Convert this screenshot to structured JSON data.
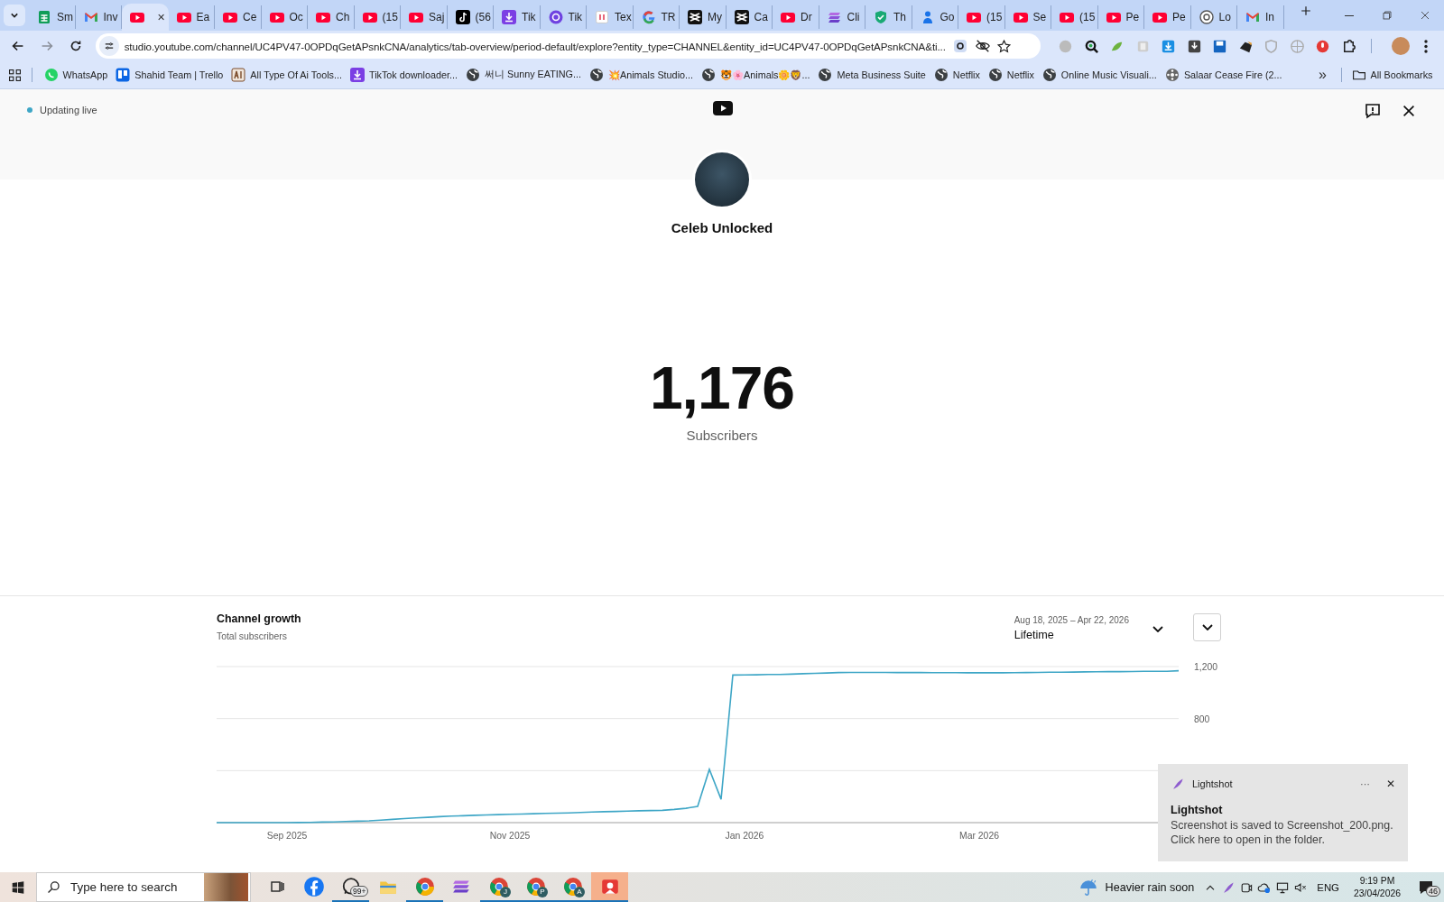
{
  "browser": {
    "tabs": [
      {
        "kind": "sheets",
        "title": "Sm",
        "selected": false
      },
      {
        "kind": "gmail",
        "title": "Inv",
        "selected": false
      },
      {
        "kind": "youtube",
        "selected": true,
        "close": "✕"
      },
      {
        "kind": "youtube",
        "title": "Ea",
        "selected": false
      },
      {
        "kind": "youtube",
        "title": "Ce",
        "selected": false
      },
      {
        "kind": "youtube",
        "title": "Oc",
        "selected": false
      },
      {
        "kind": "youtube",
        "title": "Ch",
        "selected": false
      },
      {
        "kind": "youtube",
        "title": "(15",
        "selected": false
      },
      {
        "kind": "youtube",
        "title": "Saj",
        "selected": false
      },
      {
        "kind": "tiktok",
        "title": "(56",
        "selected": false
      },
      {
        "kind": "downloader",
        "title": "Tik",
        "selected": false
      },
      {
        "kind": "tokcircle",
        "title": "Tik",
        "selected": false
      },
      {
        "kind": "doc",
        "title": "Tex",
        "selected": false
      },
      {
        "kind": "google",
        "title": "TR",
        "selected": false
      },
      {
        "kind": "capcut",
        "title": "My",
        "selected": false
      },
      {
        "kind": "capcut",
        "title": "Ca",
        "selected": false
      },
      {
        "kind": "youtube",
        "title": "Dr",
        "selected": false
      },
      {
        "kind": "clip",
        "title": "Cli",
        "selected": false
      },
      {
        "kind": "shield",
        "title": "Th",
        "selected": false
      },
      {
        "kind": "person",
        "title": "Go",
        "selected": false
      },
      {
        "kind": "youtube",
        "title": "(15",
        "selected": false
      },
      {
        "kind": "youtube",
        "title": "Se",
        "selected": false
      },
      {
        "kind": "youtube",
        "title": "(15",
        "selected": false
      },
      {
        "kind": "youtube",
        "title": "Pe",
        "selected": false
      },
      {
        "kind": "youtube",
        "title": "Pe",
        "selected": false
      },
      {
        "kind": "openai",
        "title": "Lo",
        "selected": false
      },
      {
        "kind": "gmail",
        "title": "In",
        "selected": false
      }
    ],
    "url": "studio.youtube.com/channel/UC4PV47-0OPDqGetAPsnkCNA/analytics/tab-overview/period-default/explore?entity_type=CHANNEL&entity_id=UC4PV47-0OPDqGetAPsnkCNA&ti...",
    "bookmarks": [
      {
        "kind": "whatsapp",
        "label": "WhatsApp"
      },
      {
        "kind": "trello",
        "label": "Shahid Team | Trello"
      },
      {
        "kind": "ai",
        "label": "All Type Of Ai Tools..."
      },
      {
        "kind": "downloader",
        "label": "TikTok downloader..."
      },
      {
        "kind": "globe",
        "label": "써니 Sunny EATING..."
      },
      {
        "kind": "globe",
        "label": "💥Animals Studio..."
      },
      {
        "kind": "globe",
        "label": "🐯🌸Animals🌼🦁..."
      },
      {
        "kind": "globe",
        "label": "Meta Business Suite"
      },
      {
        "kind": "globe",
        "label": "Netflix"
      },
      {
        "kind": "globe",
        "label": "Netflix"
      },
      {
        "kind": "globe",
        "label": "Online Music Visuali..."
      },
      {
        "kind": "film",
        "label": "Salaar Cease Fire (2..."
      }
    ],
    "more_bookmarks": "»",
    "all_bookmarks": "All Bookmarks"
  },
  "studio": {
    "status": "Updating live",
    "channel_name": "Celeb Unlocked",
    "subscriber_count": "1,176",
    "subscriber_label": "Subscribers",
    "growth": {
      "title": "Channel growth",
      "subtitle": "Total subscribers",
      "date_range": "Aug 18, 2025 – Apr 22, 2026",
      "period": "Lifetime",
      "chart_data": {
        "type": "line",
        "categories": [
          null,
          null,
          null,
          null,
          null,
          null,
          "Sep 2025",
          null,
          null,
          null,
          null,
          null,
          null,
          null,
          null,
          null,
          null,
          null,
          null,
          null,
          null,
          null,
          null,
          null,
          null,
          "Nov 2025",
          null,
          null,
          null,
          null,
          null,
          null,
          null,
          null,
          null,
          null,
          null,
          null,
          null,
          null,
          null,
          null,
          null,
          null,
          null,
          "Jan 2026",
          null,
          null,
          null,
          null,
          null,
          null,
          null,
          null,
          null,
          null,
          null,
          null,
          null,
          null,
          null,
          null,
          null,
          null,
          null,
          "Mar 2026",
          null,
          null,
          null,
          null,
          null,
          null,
          null,
          null,
          null,
          null,
          null,
          null,
          null,
          null,
          null,
          null,
          null
        ],
        "series": [
          {
            "color": "#3ea6c6",
            "values": [
              0,
              0,
              0,
              0,
              0,
              0,
              0,
              1,
              2,
              4,
              5,
              8,
              11,
              14,
              19,
              25,
              31,
              37,
              41,
              46,
              50,
              53,
              56,
              59,
              62,
              64,
              66,
              69,
              71,
              73,
              75,
              78,
              81,
              84,
              86,
              89,
              91,
              93,
              94,
              101,
              110,
              125,
              410,
              180,
              1135,
              1136,
              1137,
              1139,
              1140,
              1142,
              1145,
              1148,
              1151,
              1154,
              1155,
              1155,
              1155,
              1155,
              1154,
              1154,
              1154,
              1153,
              1153,
              1153,
              1152,
              1152,
              1152,
              1152,
              1153,
              1154,
              1155,
              1156,
              1157,
              1158,
              1159,
              1160,
              1161,
              1161,
              1162,
              1163,
              1164,
              1164,
              1168
            ]
          }
        ],
        "ylim": [
          0,
          1200
        ],
        "yticks": [
          {
            "value": 800,
            "label": "800"
          },
          {
            "value": 1200,
            "label": "1,200"
          }
        ]
      }
    }
  },
  "notification": {
    "app": "Lightshot",
    "title": "Lightshot",
    "message": "Screenshot is saved to Screenshot_200.png. Click here to open in the folder.",
    "more": "···",
    "close": "✕"
  },
  "taskbar": {
    "search_placeholder": "Type here to search",
    "apps": [
      {
        "kind": "taskview",
        "running": false,
        "selected": false
      },
      {
        "kind": "facebook",
        "running": false,
        "selected": false
      },
      {
        "kind": "whatsapp",
        "badge": "99+",
        "running": true,
        "selected": false
      },
      {
        "kind": "folder",
        "running": false,
        "selected": false
      },
      {
        "kind": "chrome",
        "running": true,
        "selected": false
      },
      {
        "kind": "stack",
        "running": false,
        "selected": false
      },
      {
        "kind": "chrome",
        "letter": "J",
        "running": true,
        "selected": false
      },
      {
        "kind": "chrome",
        "letter": "P",
        "running": true,
        "selected": false
      },
      {
        "kind": "chrome",
        "letter": "A",
        "running": true,
        "selected": false
      },
      {
        "kind": "recorder",
        "running": true,
        "selected": true
      }
    ],
    "weather": "Heavier rain soon",
    "language": "ENG",
    "time": "9:19 PM",
    "date": "23/04/2026",
    "notifications": "46"
  }
}
